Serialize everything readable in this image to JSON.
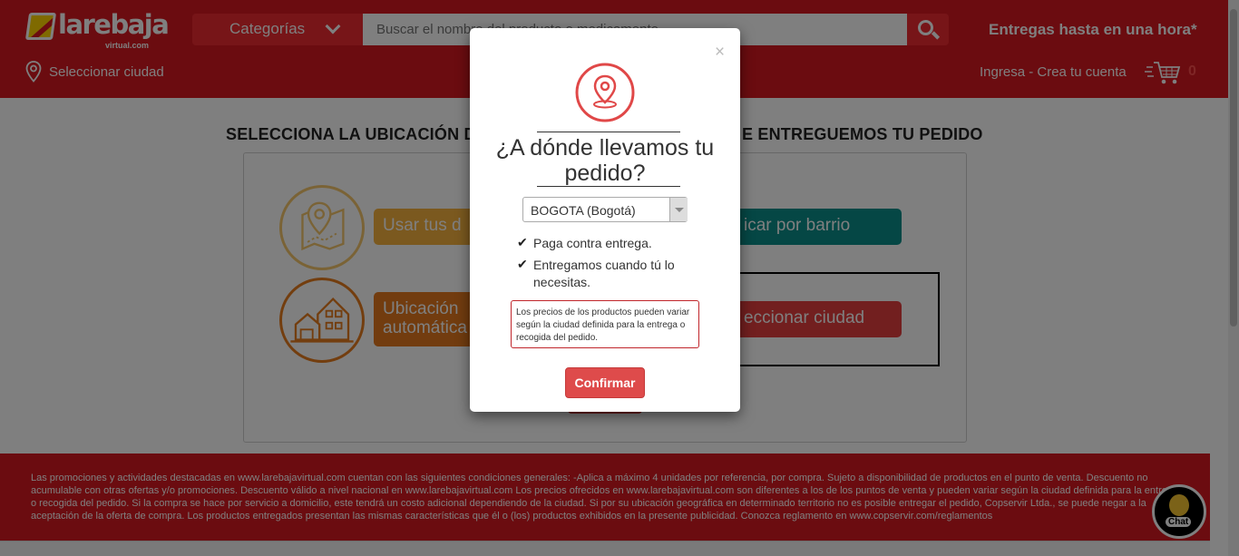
{
  "header": {
    "logo_text": "larebaja",
    "logo_sub": "virtual.com",
    "categories_label": "Categorías",
    "search_placeholder": "Buscar el nombre del producto o medicamento",
    "delivery_text": "Entregas hasta en una hora*",
    "city_link": "Seleccionar ciudad",
    "login_link": "Ingresa - Crea tu cuenta",
    "cart_count": "0"
  },
  "page": {
    "title_left": "SELECCIONA LA UBICACIÓN D",
    "title_right": "E ENTREGUEMOS TU PEDIDO",
    "options": {
      "gps_label": "Usar tus d",
      "auto_label": "Ubicación automática",
      "barrio_label": "icar por barrio",
      "city_label": "eccionar ciudad"
    }
  },
  "modal": {
    "close": "×",
    "title": "¿A dónde llevamos tu pedido?",
    "selected_city": "BOGOTA (Bogotá)",
    "features": [
      "Paga contra entrega.",
      "Entregamos cuando tú lo necesitas."
    ],
    "notice": "Los precios de los productos pueden variar según la ciudad definida para la entrega o recogida del pedido.",
    "confirm_label": "Confirmar"
  },
  "footer": {
    "promo_text": "Las promociones y actividades destacadas en www.larebajavirtual.com cuentan con las siguientes condiciones generales: -Aplica a máximo 4 unidades por referencia, por compra. Sujeto a disponibilidad de productos en el punto de venta. Descuento no acumulable con otras ofertas y/o promociones. Descuento válido a nivel nacional en www.larebajavirtual.com Los precios ofrecidos en www.larebajavirtual.com son diferentes a los de los puntos de venta y pueden variar según la ciudad definida para la entrega o recogida del pedido. Si la compra se hace por servicio a domicilio, este tendrá un costo adicional dependiendo de la ciudad. Si por su ubicación geográfica en determinado territorio no es posible entregar el pedido, Copservir Ltda., se puede negar a la aceptación de la oferta de compra. Los productos entregados presentan las mismas características que él o (los) productos exhibidos en la presente publicidad. Conozca reglamento en www.copservir.com/reglamentos",
    "chat_label": "Chat"
  },
  "colors": {
    "brand_red": "#d71920",
    "accent_red": "#ee2b31",
    "teal": "#0b8f8a",
    "orange": "#e4791e",
    "yellow": "#f7b23e"
  }
}
